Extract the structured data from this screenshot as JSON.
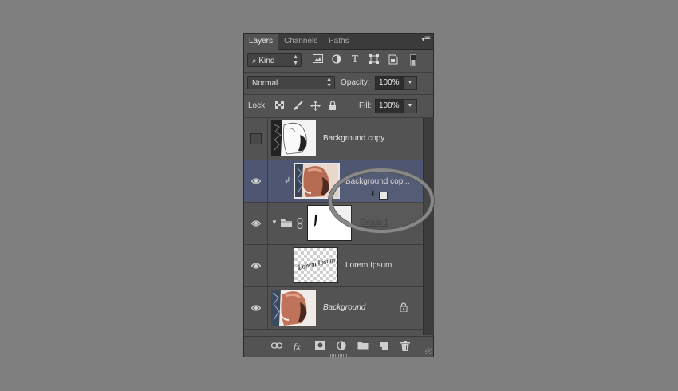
{
  "tabs": [
    {
      "label": "Layers",
      "active": true
    },
    {
      "label": "Channels",
      "active": false
    },
    {
      "label": "Paths",
      "active": false
    }
  ],
  "filter": {
    "kind_label": "Kind",
    "icons": [
      "image-filter-icon",
      "adjustment-filter-icon",
      "type-filter-icon",
      "shape-filter-icon",
      "smart-object-filter-icon",
      "filter-toggle-icon"
    ]
  },
  "blend": {
    "mode": "Normal",
    "opacity_label": "Opacity:",
    "opacity_value": "100%"
  },
  "lock": {
    "label": "Lock:",
    "icons": [
      "lock-transparent-icon",
      "lock-image-icon",
      "lock-position-icon",
      "lock-all-icon"
    ],
    "fill_label": "Fill:",
    "fill_value": "100%"
  },
  "layers": [
    {
      "name": "Background copy",
      "visible": false,
      "selected": false
    },
    {
      "name": "Background cop...",
      "visible": true,
      "selected": true,
      "clipped": true
    },
    {
      "name": "Group 1",
      "visible": true,
      "selected": false,
      "group": true
    },
    {
      "name": "Lorem Ipsum",
      "visible": true,
      "selected": false
    },
    {
      "name": "Background",
      "visible": true,
      "selected": false,
      "locked": true
    }
  ],
  "thumbnail_text": "Lorem Ipsum",
  "bottom_icons": [
    "link-layers-icon",
    "fx-icon",
    "add-mask-icon",
    "adjustment-layer-icon",
    "new-group-icon",
    "new-layer-icon",
    "delete-layer-icon"
  ],
  "fx_label": "fx",
  "colors": {
    "background": "#7f7f7f",
    "panel": "#535353",
    "selection": "#4e5672"
  }
}
